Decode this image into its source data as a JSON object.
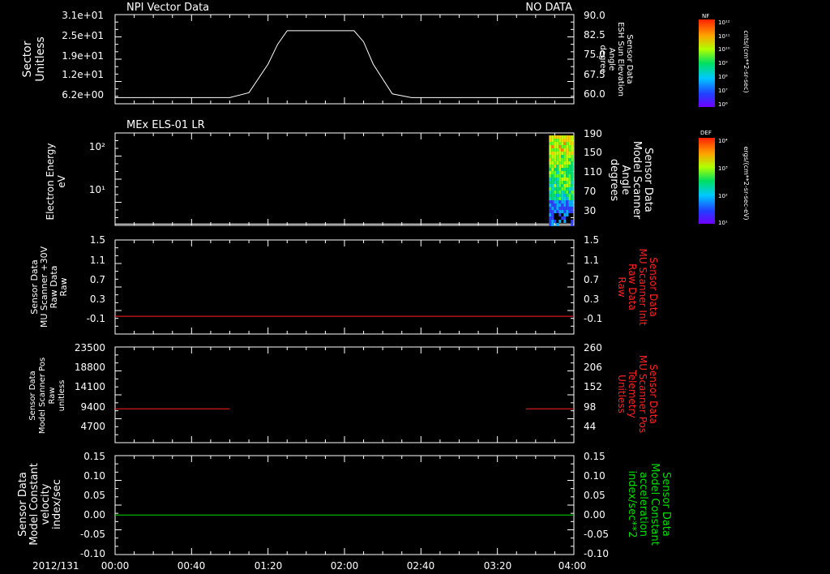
{
  "colors": {
    "background": "#000000",
    "axes": "#ffffff",
    "red": "#ff2020",
    "green": "#00dd00"
  },
  "time_axis": {
    "date_label": "2012/131",
    "ticks": [
      "00:00",
      "00:40",
      "01:20",
      "02:00",
      "02:40",
      "03:20",
      "04:00"
    ]
  },
  "chart_data": [
    {
      "id": "panel1",
      "type": "line",
      "title_left": "NPI Vector Data",
      "title_right": "NO DATA",
      "ylabel_left": [
        "Sector",
        "Unitless"
      ],
      "yticks_left": [
        "3.1e+01",
        "2.5e+01",
        "1.9e+01",
        "1.2e+01",
        "6.2e+00"
      ],
      "ylabel_right": [
        "Sensor Data",
        "ESH Sun Elevation",
        "Angle",
        "degree"
      ],
      "yticks_right": [
        "90.0",
        "82.5",
        "75.0",
        "67.5",
        "60.0"
      ],
      "ylim_right": [
        54,
        90
      ],
      "series": [
        {
          "color": "#ffffff",
          "x_minutes": [
            0,
            60,
            70,
            80,
            85,
            90,
            125,
            130,
            135,
            145,
            155,
            240
          ],
          "y": [
            56.5,
            56.5,
            58.5,
            70,
            78,
            83.5,
            83.5,
            79,
            70,
            58,
            56.5,
            56.5
          ]
        }
      ]
    },
    {
      "id": "panel2",
      "type": "heatmap",
      "title_left": "MEx ELS-01 LR",
      "ylabel_left": [
        "Electron Energy",
        "eV"
      ],
      "yticks_left": [
        "10²",
        "10¹"
      ],
      "ylabel_right": [
        "Sensor Data",
        "Model Scanner",
        "Angle",
        "degrees"
      ],
      "yticks_right": [
        "190",
        "150",
        "110",
        "70",
        "30"
      ],
      "ylim_right": [
        0,
        190
      ],
      "white_line_value": 3,
      "data_region_x_minutes": [
        227,
        240
      ]
    },
    {
      "id": "panel3",
      "type": "line",
      "ylabel_left": [
        "Sensor Data",
        "MU Scanner +30V",
        "Raw Data",
        "Raw"
      ],
      "yticks_left": [
        "1.5",
        "1.1",
        "0.7",
        "0.3",
        "-0.1"
      ],
      "ylabel_right": [
        "Sensor Data",
        "MU Scanner Inlt",
        "Raw Data",
        "Raw"
      ],
      "yticks_right": [
        "1.5",
        "1.1",
        "0.7",
        "0.3",
        "-0.1"
      ],
      "ylim": [
        -0.35,
        1.5
      ],
      "series": [
        {
          "color": "#ff2020",
          "x_minutes": [
            0,
            240
          ],
          "y": [
            0.0,
            0.0
          ]
        }
      ]
    },
    {
      "id": "panel4",
      "type": "line",
      "ylabel_left": [
        "Sensor Data",
        "Model Scanner Pos",
        "Raw",
        "unitless"
      ],
      "yticks_left": [
        "23500",
        "18800",
        "14100",
        "9400",
        "4700"
      ],
      "ylabel_right": [
        "Sensor Data",
        "MU Scanner Pos",
        "Telemetry",
        "Unitless"
      ],
      "yticks_right": [
        "260",
        "206",
        "152",
        "98",
        "44"
      ],
      "ylim": [
        0,
        23500
      ],
      "series": [
        {
          "color": "#ff2020",
          "x_minutes": [
            0,
            60
          ],
          "y": [
            8300,
            8300
          ]
        },
        {
          "color": "#ff2020",
          "x_minutes": [
            215,
            240
          ],
          "y": [
            8300,
            8300
          ]
        }
      ]
    },
    {
      "id": "panel5",
      "type": "line",
      "ylabel_left": [
        "Sensor Data",
        "Model Constant",
        "velocity",
        "index/sec"
      ],
      "yticks_left": [
        "0.15",
        "0.10",
        "0.05",
        "0.00",
        "-0.05",
        "-0.10"
      ],
      "ylabel_right": [
        "Sensor Data",
        "Model Constant",
        "acceleration",
        "index/sec**2"
      ],
      "yticks_right": [
        "0.15",
        "0.10",
        "0.05",
        "0.00",
        "-0.05",
        "-0.10"
      ],
      "ylim": [
        -0.1,
        0.15
      ],
      "series": [
        {
          "color": "#00dd00",
          "x_minutes": [
            0,
            240
          ],
          "y": [
            0.0,
            0.0
          ]
        }
      ]
    }
  ],
  "colorbars": [
    {
      "id": "cb1",
      "title": "NF",
      "ticks": [
        "10¹²",
        "10¹¹",
        "10¹⁰",
        "10⁹",
        "10⁸",
        "10⁷",
        "10⁶"
      ],
      "label": "cnts/(cm**2-sr-sec)"
    },
    {
      "id": "cb2",
      "title": "DEF",
      "ticks": [
        "10⁴",
        "10³",
        "10²",
        "10¹"
      ],
      "label": "ergs/(cm**2-sr-sec-eV)"
    }
  ]
}
